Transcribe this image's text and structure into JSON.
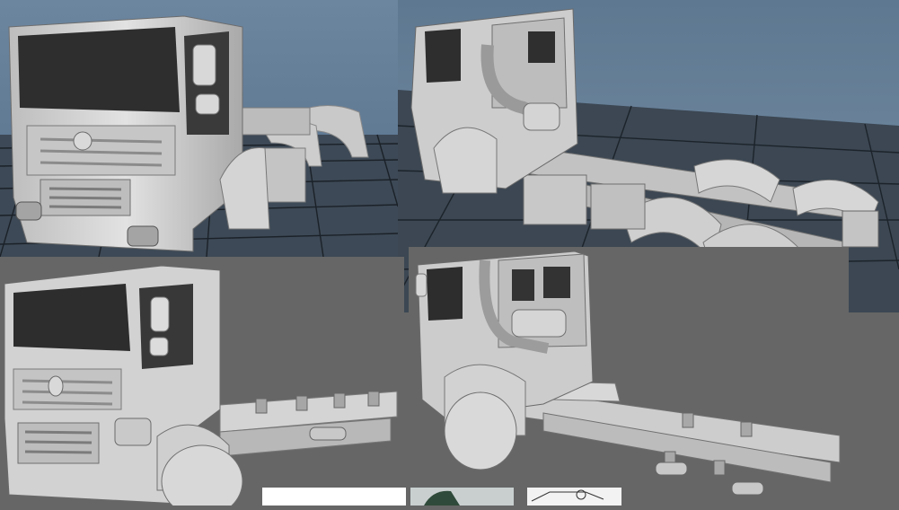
{
  "scene": {
    "panels": [
      {
        "view": "front-three-quarter",
        "model": "tractor-cab-with-fifth-wheel",
        "background": "viewport-grid"
      },
      {
        "view": "rear-three-quarter",
        "model": "tractor-chassis-tandem-axle",
        "background": "viewport-grid"
      },
      {
        "view": "front-three-quarter",
        "model": "rigid-chassis-cab",
        "background": "flat-gray"
      },
      {
        "view": "rear-three-quarter",
        "model": "rigid-chassis-cab",
        "background": "flat-gray"
      }
    ],
    "colors": {
      "viewport_sky": "#5f7a93",
      "viewport_floor": "#3c4753",
      "grid_line": "#1d2329",
      "flat_background": "#666666",
      "model_body": "#d3d3d3",
      "model_shadow": "#8e8e8e",
      "model_dark": "#3a3a3a"
    }
  }
}
